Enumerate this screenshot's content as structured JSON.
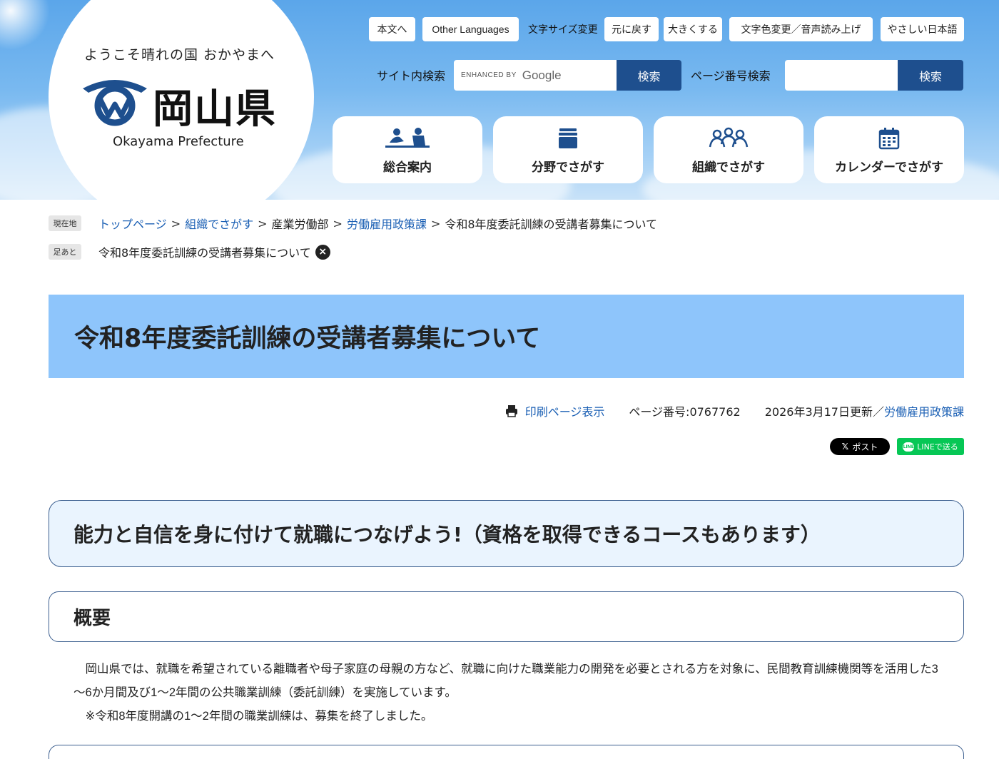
{
  "header": {
    "logo": {
      "tagline": "ようこそ晴れの国 おかやまへ",
      "name": "岡山県",
      "name_en": "Okayama Prefecture",
      "brand_color": "#1e4f8e"
    },
    "utility": {
      "skip_to_content": "本文へ",
      "other_languages": "Other Languages",
      "font_size_label": "文字サイズ変更",
      "font_reset": "元に戻す",
      "font_larger": "大きくする",
      "color_voice": "文字色変更／音声読み上げ",
      "easy_japanese": "やさしい日本語"
    },
    "site_search": {
      "label": "サイト内検索",
      "enhanced_by": "ENHANCED BY",
      "provider": "Google",
      "button": "検索"
    },
    "page_number_search": {
      "label": "ページ番号検索",
      "button": "検索"
    },
    "nav": [
      {
        "label": "総合案内",
        "icon": "people-desk-icon"
      },
      {
        "label": "分野でさがす",
        "icon": "stack-books-icon"
      },
      {
        "label": "組織でさがす",
        "icon": "group-people-icon"
      },
      {
        "label": "カレンダーでさがす",
        "icon": "calendar-icon"
      }
    ]
  },
  "breadcrumb": {
    "current_tag": "現在地",
    "items": [
      "トップページ",
      "組織でさがす",
      "産業労働部",
      "労働雇用政策課",
      "令和8年度委託訓練の受講者募集について"
    ],
    "separator": ">",
    "history_tag": "足あと",
    "history_item": "令和8年度委託訓練の受講者募集について"
  },
  "page": {
    "title": "令和8年度委託訓練の受講者募集について",
    "print_link": "印刷ページ表示",
    "page_number": "ページ番号:0767762",
    "updated": "2026年3月17日更新／",
    "department": "労働雇用政策課",
    "share_x": "ポスト",
    "share_line": "LINEで送る"
  },
  "content": {
    "heading": "能力と自信を身に付けて就職につなげよう!（資格を取得できるコースもあります）",
    "section_title": "概要",
    "paragraph1": "岡山県では、就職を希望されている離職者や母子家庭の母親の方など、就職に向けた職業能力の開発を必要とされる方を対象に、民間教育訓練機関等を活用した3～6か月間及び1～2年間の公共職業訓練（委託訓練）を実施しています。",
    "paragraph2": "※令和8年度開講の1～2年間の職業訓練は、募集を終了しました。"
  },
  "colors": {
    "title_bg": "#8ec5fb",
    "heading_bg": "#eaf4fe",
    "border": "#3c5f8f",
    "link": "#1a5fb4"
  }
}
